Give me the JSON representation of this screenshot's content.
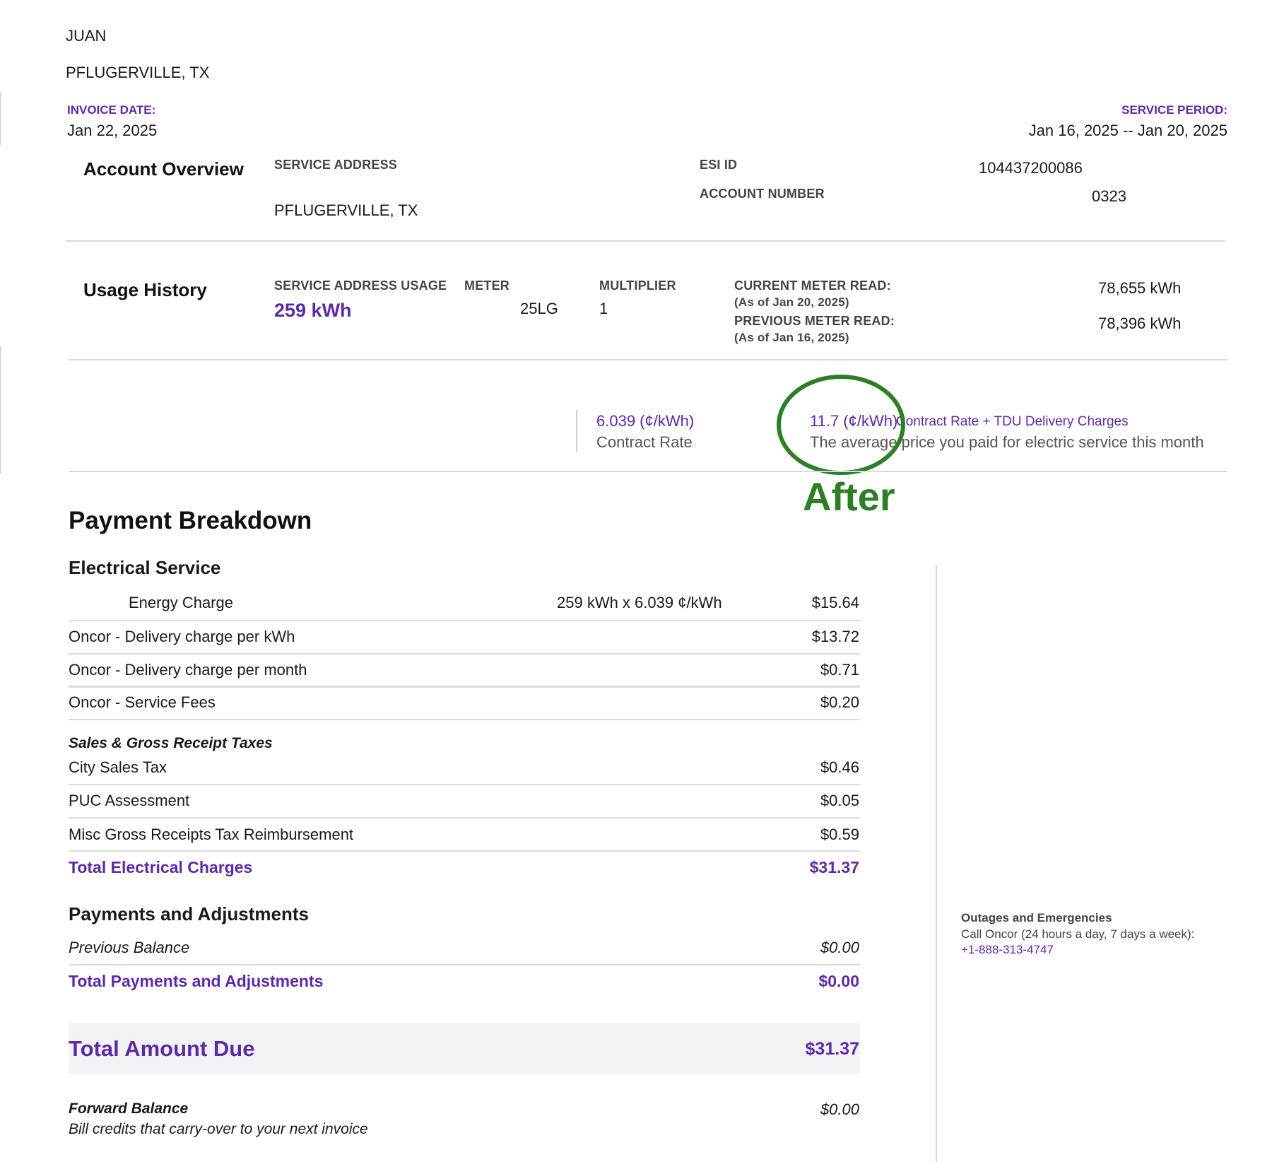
{
  "customer": {
    "name": "JUAN",
    "city": "PFLUGERVILLE, TX"
  },
  "invoice": {
    "date_label": "INVOICE DATE:",
    "date": "Jan 22, 2025"
  },
  "service_period": {
    "label": "SERVICE PERIOD:",
    "value": "Jan 16, 2025 -- Jan 20, 2025"
  },
  "account_overview": {
    "title": "Account Overview",
    "service_address_label": "SERVICE ADDRESS",
    "service_address": "PFLUGERVILLE, TX",
    "esi_label": "ESI ID",
    "esi_value": "104437200086",
    "account_label": "ACCOUNT NUMBER",
    "account_value": "0323"
  },
  "usage_history": {
    "title": "Usage History",
    "usage_label": "SERVICE ADDRESS USAGE",
    "usage_value": "259 kWh",
    "meter_label": "METER",
    "meter_value": "25LG",
    "multiplier_label": "MULTIPLIER",
    "multiplier_value": "1",
    "current_read_label": "CURRENT METER READ:",
    "current_read_date": "(As of Jan 20, 2025)",
    "current_read_value": "78,655 kWh",
    "previous_read_label": "PREVIOUS METER READ:",
    "previous_read_date": "(As of Jan 16, 2025)",
    "previous_read_value": "78,396 kWh"
  },
  "rates": {
    "contract_rate_value": "6.039 (¢/kWh)",
    "contract_rate_label": "Contract Rate",
    "avg_rate_value": "11.7 (¢/kWh)",
    "avg_rate_title": "Contract Rate + TDU Delivery Charges",
    "avg_rate_desc": "The average price you paid for electric service this month"
  },
  "annotation": {
    "text": "After",
    "color": "#2e7d27"
  },
  "payment_breakdown": {
    "title": "Payment Breakdown",
    "electrical_title": "Electrical Service",
    "energy": {
      "label": "Energy Charge",
      "calc": "259 kWh x 6.039 ¢/kWh",
      "amount": "$15.64"
    },
    "rows": [
      {
        "label": "Oncor - Delivery charge per kWh",
        "amount": "$13.72"
      },
      {
        "label": "Oncor - Delivery charge per month",
        "amount": "$0.71"
      },
      {
        "label": "Oncor - Service Fees",
        "amount": "$0.20"
      }
    ],
    "taxes_title": "Sales & Gross Receipt Taxes",
    "tax_rows": [
      {
        "label": "City Sales Tax",
        "amount": "$0.46"
      },
      {
        "label": "PUC Assessment",
        "amount": "$0.05"
      },
      {
        "label": "Misc Gross Receipts Tax Reimbursement",
        "amount": "$0.59"
      }
    ],
    "total_electrical_label": "Total Electrical Charges",
    "total_electrical_amount": "$31.37",
    "payments_title": "Payments and Adjustments",
    "previous_balance_label": "Previous Balance",
    "previous_balance_amount": "$0.00",
    "total_payments_label": "Total Payments and Adjustments",
    "total_payments_amount": "$0.00",
    "total_due_label": "Total Amount Due",
    "total_due_amount": "$31.37",
    "forward_balance_label": "Forward Balance",
    "forward_balance_desc": "Bill credits that carry-over to your next invoice",
    "forward_balance_amount": "$0.00"
  },
  "outages": {
    "title": "Outages and Emergencies",
    "desc": "Call Oncor (24 hours a day, 7 days a week):",
    "phone": "+1-888-313-4747"
  },
  "colors": {
    "accent": "#5b2aa8",
    "annotation": "#2e7d27"
  }
}
